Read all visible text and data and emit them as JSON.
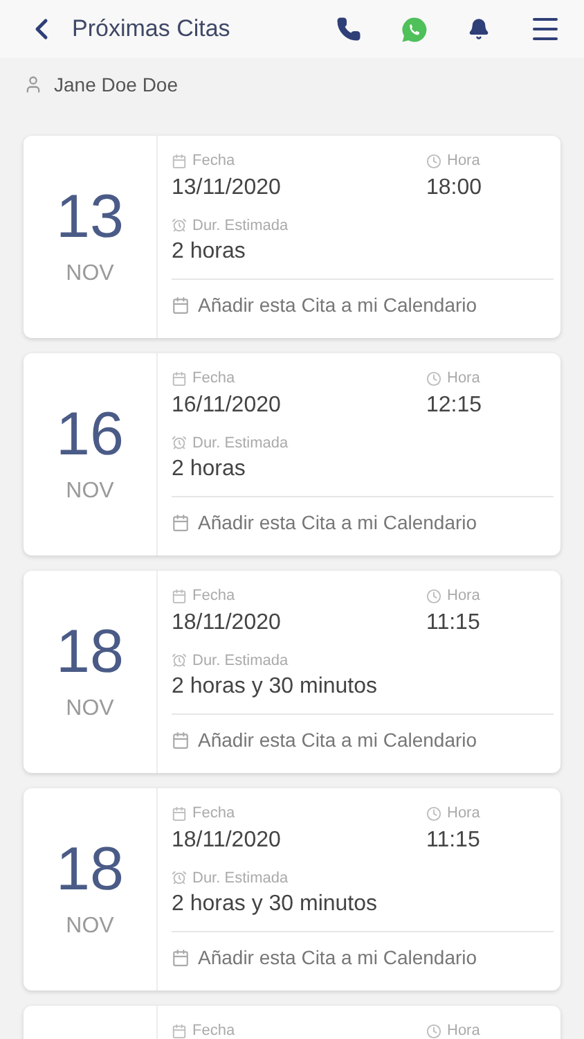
{
  "header": {
    "title": "Próximas Citas"
  },
  "user": {
    "name": "Jane Doe Doe"
  },
  "appointments": [
    {
      "day": "13",
      "month": "NOV",
      "date_label": "Fecha",
      "date": "13/11/2020",
      "time_label": "Hora",
      "time": "18:00",
      "duration_label": "Dur. Estimada",
      "duration": "2 horas",
      "add_calendar": "Añadir esta Cita a mi Calendario"
    },
    {
      "day": "16",
      "month": "NOV",
      "date_label": "Fecha",
      "date": "16/11/2020",
      "time_label": "Hora",
      "time": "12:15",
      "duration_label": "Dur. Estimada",
      "duration": "2 horas",
      "add_calendar": "Añadir esta Cita a mi Calendario"
    },
    {
      "day": "18",
      "month": "NOV",
      "date_label": "Fecha",
      "date": "18/11/2020",
      "time_label": "Hora",
      "time": "11:15",
      "duration_label": "Dur. Estimada",
      "duration": "2 horas y 30 minutos",
      "add_calendar": "Añadir esta Cita a mi Calendario"
    },
    {
      "day": "18",
      "month": "NOV",
      "date_label": "Fecha",
      "date": "18/11/2020",
      "time_label": "Hora",
      "time": "11:15",
      "duration_label": "Dur. Estimada",
      "duration": "2 horas y 30 minutos",
      "add_calendar": "Añadir esta Cita a mi Calendario"
    },
    {
      "date_label": "Fecha",
      "time_label": "Hora"
    }
  ]
}
